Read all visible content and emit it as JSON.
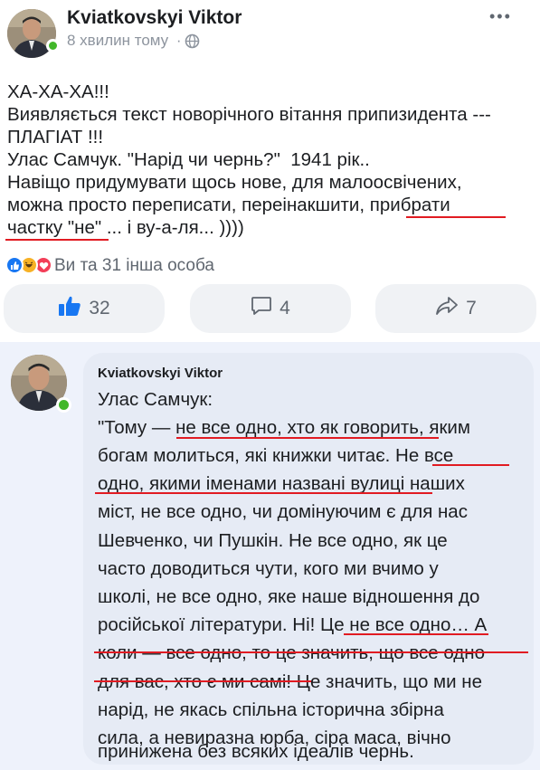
{
  "post": {
    "author": "Kviatkovskyi Viktor",
    "time": "8 хвилин тому",
    "dot": "·",
    "privacy_icon": "globe-icon",
    "more_label": "•••",
    "lines": [
      "ХА-ХА-ХА!!!",
      "Виявляється текст новорічного вітання припизидента ---",
      "ПЛАГІАТ !!!",
      "Улас Самчук. \"Нарід чи чернь?\"  1941 рік..",
      "Навіщо придумувати щось нове, для малоосвічених,",
      "можна просто переписати, переінакшити, прибрати",
      "частку \"не\" ... і ву-а-ля... ))))"
    ]
  },
  "reactions": {
    "icons": [
      "like-reaction-icon",
      "haha-reaction-icon",
      "love-reaction-icon"
    ],
    "text": "Ви та 31 інша особа"
  },
  "actions": {
    "like": {
      "icon": "thumbs-up-icon",
      "count": "32"
    },
    "comment": {
      "icon": "comment-icon",
      "count": "4"
    },
    "share": {
      "icon": "share-icon",
      "count": "7"
    }
  },
  "comment": {
    "author": "Kviatkovskyi Viktor",
    "lines": [
      "Улас Самчук:",
      "\"Тому — не все одно, хто як говорить, яким",
      "богам молиться, які книжки читає. Не все",
      "одно, якими іменами названі вулиці наших",
      "міст, не все одно, чи домінуючим є для нас",
      "Шевченко, чи Пушкін. Не все одно, як це",
      "часто доводиться чути, кого ми вчимо у",
      "школі, не все одно, яке наше відношення до",
      "російської літератури. Ні! Це не все одно… А",
      "коли — все одно, то це значить, що все одно",
      "для вас, хто є ми самі! Це значить, що ми не",
      "нарід, не якась спільна історична збірна",
      "сила, а невиразна юрба, сіра маса, вічно",
      "принижена без всяких ідеалів чернь."
    ]
  },
  "colors": {
    "underline": "#e11b22",
    "like_blue": "#1877f2",
    "online_green": "#42b72a",
    "comment_bg": "#e6ebf5"
  }
}
